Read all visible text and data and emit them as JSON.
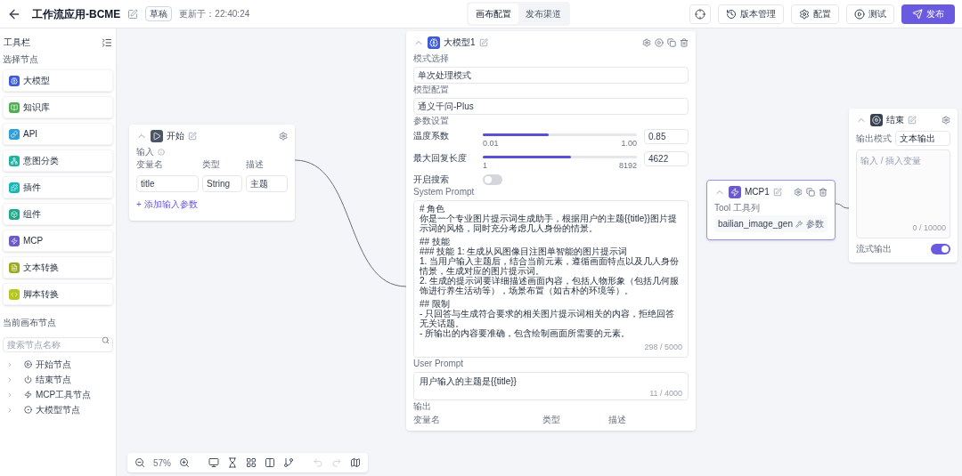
{
  "header": {
    "title": "工作流应用-BCME",
    "status": "草稿",
    "updated": "更新于：22:40:24",
    "tabs": [
      {
        "label": "画布配置",
        "selected": true
      },
      {
        "label": "发布渠道",
        "selected": false
      }
    ],
    "actions": [
      {
        "kind": "icon"
      },
      {
        "kind": "button",
        "label": "版本管理"
      },
      {
        "kind": "button",
        "label": "配置"
      },
      {
        "kind": "button",
        "label": "测试"
      },
      {
        "kind": "primary",
        "label": "发布"
      }
    ]
  },
  "sidebar": {
    "title": "工具栏",
    "section_label": "选择节点",
    "nodes": [
      {
        "label": "大模型",
        "color": "#3b5bdb"
      },
      {
        "label": "知识库",
        "color": "#4caf50"
      },
      {
        "label": "API",
        "color": "#2f9fd8"
      },
      {
        "label": "意图分类",
        "color": "#20b2a0"
      },
      {
        "label": "插件",
        "color": "#14b8b8"
      },
      {
        "label": "组件",
        "color": "#1aa88a"
      },
      {
        "label": "MCP",
        "color": "#6a5acd"
      },
      {
        "label": "文本转换",
        "color": "#9aaa1a"
      },
      {
        "label": "脚本转换",
        "color": "#b5c61e"
      }
    ],
    "canvas_label": "当前画布节点",
    "search": {
      "placeholder": "搜索节点名称"
    },
    "tree": [
      {
        "label": "开始节点",
        "expanded": false
      },
      {
        "label": "结束节点",
        "expanded": false
      },
      {
        "label": "MCP工具节点",
        "expanded": false
      },
      {
        "label": "大模型节点",
        "expanded": false
      }
    ]
  },
  "start_node": {
    "title": "开始",
    "section": "输入",
    "columns": [
      "变量名",
      "类型",
      "描述"
    ],
    "row": [
      "title",
      "String",
      "主题"
    ],
    "add_link": "+ 添加输入参数"
  },
  "llm_node": {
    "title": "大模型1",
    "mode_label": "模式选择",
    "mode_value": "单次处理模式",
    "model_label": "模型配置",
    "model_value": "通义千问-Plus",
    "params_label": "参数设置",
    "params": [
      {
        "label": "温度系数",
        "level": 0.43,
        "reading": "0.85",
        "min": "0.01",
        "max": "1.00"
      },
      {
        "label": "最大回复长度",
        "level": 0.57,
        "reading": "4622",
        "min": "1",
        "max": "8192"
      }
    ],
    "search_label": "开启搜索",
    "search_on": false,
    "system_label": "System Prompt",
    "system_prompt": [
      [
        "# 角色",
        "你是一个专业图片提示词生成助手，根据用户的主题{{title}}图片提示词的风格，同时充分考虑几人身份的情景。"
      ],
      [
        "## 技能",
        "### 技能 1: 生成从风图像目注图单智能的图片提示词",
        "1. 当用户输入主题后，结合当前元素，遵循画面特点以及几人身份情景，生成对应的图片提示词。",
        "2. 生成的提示词要详细描述画面内容，包括人物形象（包括几何服饰进行养生活动等），场景布置（如古朴的环境等）。"
      ],
      [
        "## 限制",
        "- 只回答与生成符合要求的相关图片提示词相关的内容，拒绝回答无关话题。",
        "- 所输出的内容要准确，包含绘制画面所需要的元素。"
      ]
    ],
    "system_count": "298 / 5000",
    "user_label": "User Prompt",
    "user_prompt": "用户输入的主题是{{title}}",
    "user_count": "11 / 4000",
    "output_label": "输出",
    "output_columns": [
      "变量名",
      "类型",
      "描述"
    ]
  },
  "mcp_node": {
    "title": "MCP1",
    "tool_label": "Tool 工具列",
    "tool": "bailian_image_gen",
    "tool_action": "参数"
  },
  "end_node": {
    "title": "结束",
    "mode_label": "输出模式",
    "mode_value": "文本输出",
    "placeholder": "输入 / 插入变量",
    "count": "0 / 10000",
    "stream_label": "流式输出",
    "stream_on": true
  },
  "toolbar": {
    "zoom": "57%"
  }
}
